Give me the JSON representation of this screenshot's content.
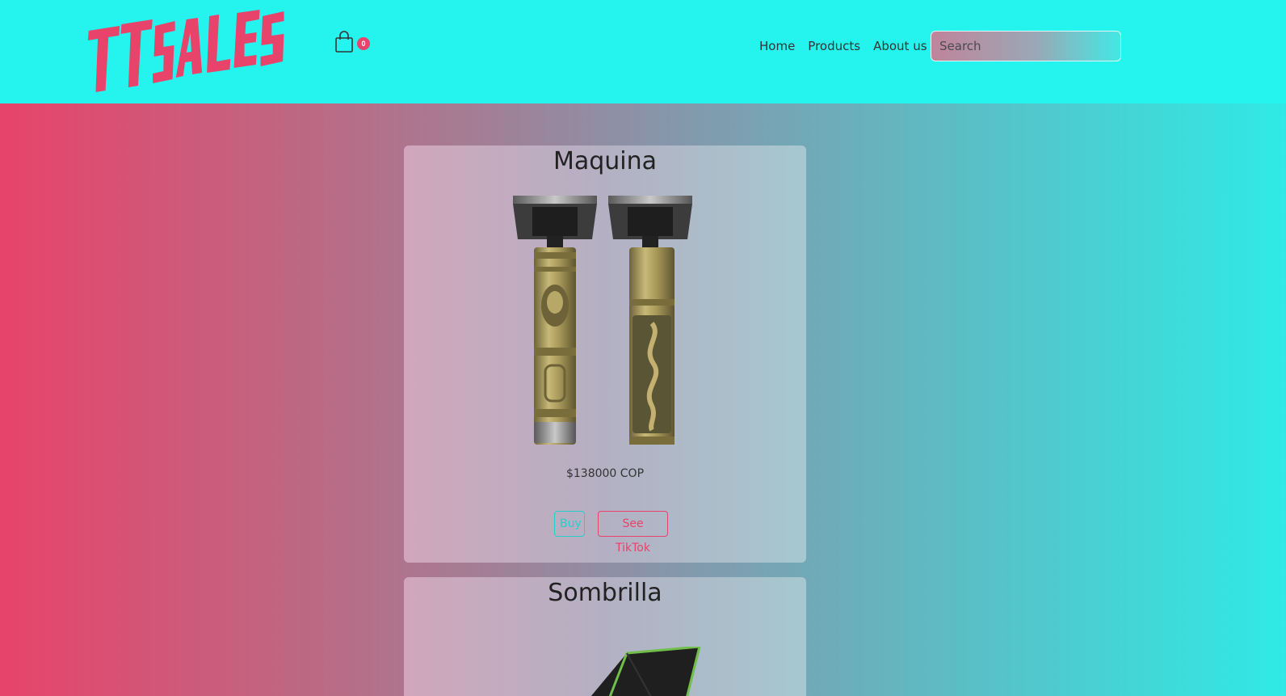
{
  "header": {
    "logo_text": "TTSALES",
    "cart_count": "0",
    "nav": [
      "Home",
      "Products",
      "About us"
    ],
    "search_placeholder": "Search"
  },
  "colors": {
    "header_bg": "#25f4ee",
    "brand_red": "#e8436a",
    "brand_cyan": "#25f4ee"
  },
  "products": [
    {
      "title": "Maquina",
      "price": "$138000 COP",
      "buy_label": "Buy",
      "tiktok_label": "See TikTok"
    },
    {
      "title": "Sombrilla"
    }
  ]
}
